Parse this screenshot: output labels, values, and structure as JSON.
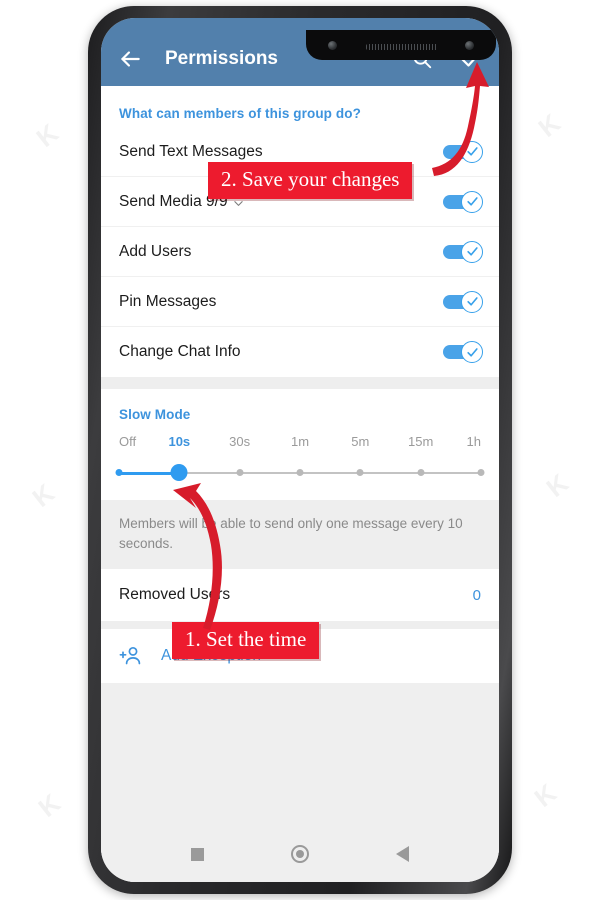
{
  "app": {
    "title": "Permissions",
    "header_color": "#5280ac",
    "accent_color": "#3d93dd",
    "icons": {
      "back": "arrow-left-icon",
      "search": "search-icon",
      "confirm": "check-icon"
    }
  },
  "permissions_section": {
    "title": "What can members of this group do?",
    "rows": [
      {
        "label": "Send Text Messages",
        "enabled": true,
        "has_chevron": false
      },
      {
        "label": "Send Media 9/9",
        "enabled": true,
        "has_chevron": true
      },
      {
        "label": "Add Users",
        "enabled": true,
        "has_chevron": false
      },
      {
        "label": "Pin Messages",
        "enabled": true,
        "has_chevron": false
      },
      {
        "label": "Change Chat Info",
        "enabled": true,
        "has_chevron": false
      }
    ]
  },
  "slow_mode": {
    "title": "Slow Mode",
    "options": [
      "Off",
      "10s",
      "30s",
      "1m",
      "5m",
      "15m",
      "1h"
    ],
    "selected_index": 1,
    "selected_value": "10s",
    "description": "Members will be able to send only one message every 10 seconds."
  },
  "removed_users": {
    "label": "Removed Users",
    "count": "0"
  },
  "add_exception": {
    "label": "Add Exception",
    "icon": "add-person-icon"
  },
  "navbar": {
    "recents": "recents-square-icon",
    "home": "home-circle-icon",
    "back": "back-triangle-icon"
  },
  "annotations": {
    "step1": "1. Set the time",
    "step2": "2. Save your changes",
    "color": "#ed1b2e"
  },
  "watermarks": [
    "K",
    "K",
    "K",
    "K",
    "K",
    "K"
  ]
}
